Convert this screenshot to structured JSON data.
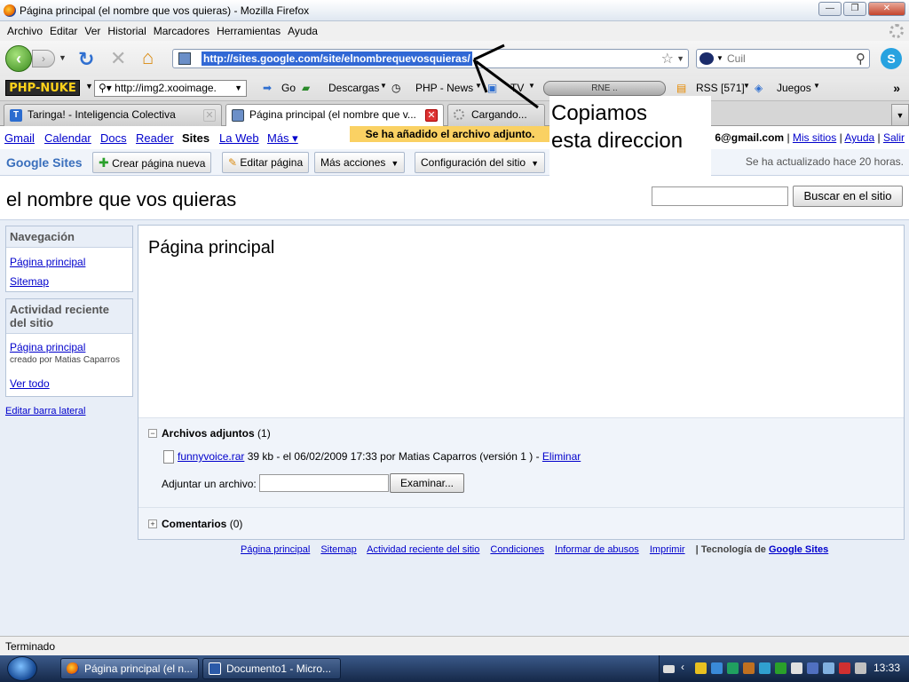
{
  "window": {
    "title": "Página principal (el nombre que vos quieras) - Mozilla Firefox",
    "btn_min": "—",
    "btn_max": "❐",
    "btn_close": "✕"
  },
  "menu": [
    "Archivo",
    "Editar",
    "Ver",
    "Historial",
    "Marcadores",
    "Herramientas",
    "Ayuda"
  ],
  "nav": {
    "url": "http://sites.google.com/site/elnombrequevosquieras/",
    "search_placeholder": "Cuil"
  },
  "bookmarks": {
    "logo": "PHP-NUKE",
    "combo_value": "http://img2.xooimage.",
    "go": "Go",
    "descargas": "Descargas",
    "php_news": "PHP - News",
    "tv": "TV",
    "player_label": "RNE ..",
    "rss": "RSS [571]",
    "juegos": "Juegos"
  },
  "tabs": [
    {
      "label": "Taringa! - Inteligencia Colectiva",
      "icon": "T"
    },
    {
      "label": "Página principal (el nombre que v...",
      "icon": ""
    },
    {
      "label": "Cargando...",
      "icon": ""
    }
  ],
  "gbar": {
    "links": [
      "Gmail",
      "Calendar",
      "Docs",
      "Reader"
    ],
    "current": "Sites",
    "more_links": [
      "La Web",
      "Más ▾"
    ],
    "notice": "Se ha añadido el archivo adjunto.",
    "email": "6@gmail.com",
    "right_links": [
      "Mis sitios",
      "Ayuda",
      "Salir"
    ]
  },
  "toolbar": {
    "logo": "Google Sites",
    "create_page": "Crear página nueva",
    "edit_page": "Editar página",
    "more_actions": "Más acciones",
    "site_config": "Configuración del sitio",
    "updated": "Se ha actualizado hace 20 horas."
  },
  "site": {
    "title": "el nombre que vos quieras",
    "search_button": "Buscar en el sitio"
  },
  "sidebar": {
    "nav_header": "Navegación",
    "nav_links": [
      "Página principal",
      "Sitemap"
    ],
    "activity_header": "Actividad reciente del sitio",
    "activity_link": "Página principal",
    "activity_meta": "creado por Matias Caparros",
    "view_all": "Ver todo",
    "edit_sidebar": "Editar barra lateral"
  },
  "main": {
    "page_title": "Página principal",
    "attachments_header": "Archivos adjuntos",
    "attachments_count": "(1)",
    "file_name": "funnyvoice.rar",
    "file_meta": "39 kb - el 06/02/2009 17:33 por Matias Caparros (versión 1 ) -",
    "file_delete": "Eliminar",
    "upload_label": "Adjuntar un archivo:",
    "browse_button": "Examinar...",
    "comments_header": "Comentarios",
    "comments_count": "(0)"
  },
  "footer": {
    "links": [
      "Página principal",
      "Sitemap",
      "Actividad reciente del sitio",
      "Condiciones",
      "Informar de abusos",
      "Imprimir"
    ],
    "tech_label": "| Tecnología de",
    "tech_link": "Google Sites"
  },
  "annotation": {
    "line1": "Copiamos",
    "line2": "esta direccion"
  },
  "status": "Terminado",
  "taskbar": {
    "tasks": [
      "Página principal (el n...",
      "Documento1 - Micro..."
    ],
    "clock": "13:33"
  },
  "colors": {
    "link": "#0000cc",
    "notice_bg": "#fad163",
    "sites_blue": "#3a6fbc",
    "body_bg": "#e8eef7"
  }
}
